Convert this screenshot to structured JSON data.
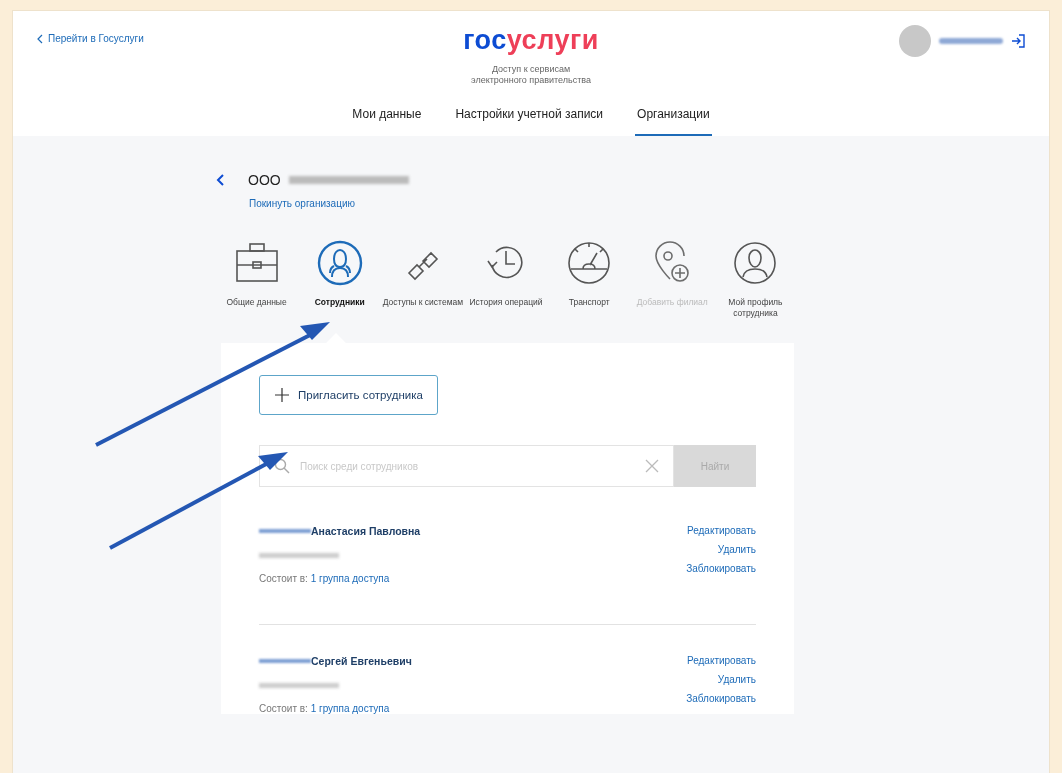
{
  "header": {
    "back_link": "Перейти в Госуслуги",
    "logo": {
      "part_1": "гос",
      "part_2": "услуги"
    },
    "subtitle": [
      "Доступ к сервисам",
      "электронного правительства"
    ]
  },
  "tabs": [
    {
      "label": "Мои данные",
      "selected": false
    },
    {
      "label": "Настройки учетной записи",
      "selected": false
    },
    {
      "label": "Организации",
      "selected": true
    }
  ],
  "organization": {
    "prefix": "ООО",
    "leave_link": "Покинуть организацию"
  },
  "sections": [
    {
      "kind": "briefcase",
      "label": "Общие данные",
      "selected": false,
      "disabled": false
    },
    {
      "kind": "people",
      "label": "Сотрудники",
      "selected": true,
      "disabled": false
    },
    {
      "kind": "link",
      "label": "Доступы к системам",
      "selected": false,
      "disabled": false
    },
    {
      "kind": "history",
      "label": "История операций",
      "selected": false,
      "disabled": false
    },
    {
      "kind": "gauge",
      "label": "Транспорт",
      "selected": false,
      "disabled": false
    },
    {
      "kind": "pin",
      "label": "Добавить филиал",
      "selected": false,
      "disabled": true
    },
    {
      "kind": "person",
      "label": "Мой профиль сотрудника",
      "selected": false,
      "disabled": false
    }
  ],
  "invite_button": "Пригласить сотрудника",
  "search": {
    "placeholder": "Поиск среди сотрудников",
    "button": "Найти"
  },
  "employees": [
    {
      "name": "Анастасия Павловна",
      "member_prefix": "Состоит в:",
      "group_link": "1 группа доступа",
      "actions": [
        "Редактировать",
        "Удалить",
        "Заблокировать"
      ]
    },
    {
      "name": "Сергей Евгеньевич",
      "member_prefix": "Состоит в:",
      "group_link": "1 группа доступа",
      "actions": [
        "Редактировать",
        "Удалить",
        "Заблокировать"
      ]
    }
  ]
}
